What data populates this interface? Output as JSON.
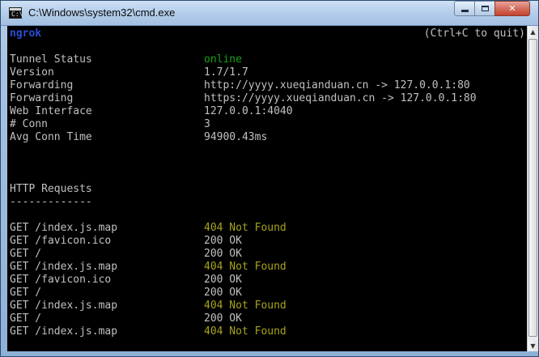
{
  "window": {
    "title": "C:\\Windows\\system32\\cmd.exe",
    "icon": "cmd-icon",
    "prompt_glyph": "C:\\",
    "close_glyph": "✕"
  },
  "colors": {
    "background": "#000000",
    "text": "#c0c0c0",
    "title_blue": "#2a4cd6",
    "status_green": "#1aa11a",
    "not_found_yellow": "#a8a31c"
  },
  "console": {
    "app_name": "ngrok",
    "quit_hint": "(Ctrl+C to quit)",
    "status_rows": [
      {
        "label": "Tunnel Status",
        "value": "online"
      },
      {
        "label": "Version",
        "value": "1.7/1.7"
      },
      {
        "label": "Forwarding",
        "value": "http://yyyy.xueqianduan.cn -> 127.0.0.1:80"
      },
      {
        "label": "Forwarding",
        "value": "https://yyyy.xueqianduan.cn -> 127.0.0.1:80"
      },
      {
        "label": "Web Interface",
        "value": "127.0.0.1:4040"
      },
      {
        "label": "# Conn",
        "value": "3"
      },
      {
        "label": "Avg Conn Time",
        "value": "94900.43ms"
      }
    ],
    "requests_heading": "HTTP Requests",
    "requests_underline": "-------------",
    "requests": [
      {
        "request": "GET /index.js.map",
        "status": "404 Not Found"
      },
      {
        "request": "GET /favicon.ico",
        "status": "200 OK"
      },
      {
        "request": "GET /",
        "status": "200 OK"
      },
      {
        "request": "GET /index.js.map",
        "status": "404 Not Found"
      },
      {
        "request": "GET /favicon.ico",
        "status": "200 OK"
      },
      {
        "request": "GET /",
        "status": "200 OK"
      },
      {
        "request": "GET /index.js.map",
        "status": "404 Not Found"
      },
      {
        "request": "GET /",
        "status": "200 OK"
      },
      {
        "request": "GET /index.js.map",
        "status": "404 Not Found"
      }
    ]
  }
}
